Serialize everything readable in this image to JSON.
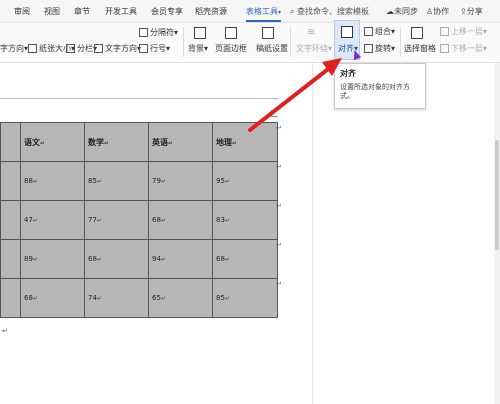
{
  "tabs": [
    {
      "label": "审阅"
    },
    {
      "label": "视图"
    },
    {
      "label": "章节"
    },
    {
      "label": "开发工具"
    },
    {
      "label": "会员专享"
    },
    {
      "label": "稻壳资源"
    },
    {
      "label": "表格工具",
      "active": true
    }
  ],
  "search": {
    "label": "查找命令、搜索模板"
  },
  "topright": {
    "sync": "未同步",
    "collab": "协作",
    "share": "分享"
  },
  "ribbon": {
    "text_direction": "文字方向",
    "paper_size": "纸张大小",
    "columns": "分栏",
    "text_direction2": "文字方向",
    "separator": "分隔符",
    "line_number": "行号",
    "background": "背景",
    "page_border": "页面边框",
    "draft_setting": "稿纸设置",
    "text_wrap": "文字环绕",
    "align": "对齐",
    "group": "组合",
    "rotate": "旋转",
    "selection_pane": "选择窗格",
    "bring_forward": "上移一层",
    "send_backward": "下移一层"
  },
  "tooltip": {
    "title": "对齐",
    "description": "设置所选对象的对齐方式。"
  },
  "table": {
    "header": [
      "",
      "语文",
      "数学",
      "英语",
      "地理"
    ],
    "rows": [
      [
        "",
        "88",
        "85",
        "79",
        "95"
      ],
      [
        "",
        "47",
        "77",
        "68",
        "83"
      ],
      [
        "",
        "89",
        "68",
        "94",
        "68"
      ],
      [
        "",
        "68",
        "74",
        "65",
        "85"
      ]
    ],
    "mark": "↵"
  },
  "colors": {
    "accent": "#2a69c9",
    "table_fill": "#b7b7b7",
    "arrow": "#e02020",
    "cursor": "#7b2fd0"
  }
}
